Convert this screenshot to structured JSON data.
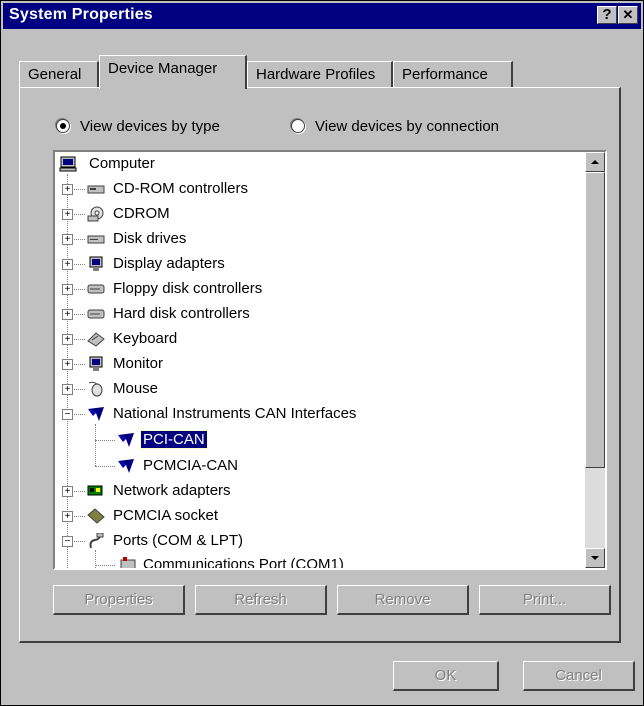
{
  "window": {
    "title": "System Properties",
    "help_label": "?",
    "close_label": "✕"
  },
  "tabs": [
    {
      "label": "General"
    },
    {
      "label": "Device Manager"
    },
    {
      "label": "Hardware Profiles"
    },
    {
      "label": "Performance"
    }
  ],
  "view_options": {
    "by_type": {
      "label": "View devices by type",
      "selected": true
    },
    "by_connection": {
      "label": "View devices by connection",
      "selected": false
    }
  },
  "tree": {
    "root": "Computer",
    "items": [
      {
        "label": "CD-ROM controllers",
        "icon": "cdrom-controller-icon"
      },
      {
        "label": "CDROM",
        "icon": "cdrom-icon"
      },
      {
        "label": "Disk drives",
        "icon": "disk-drive-icon"
      },
      {
        "label": "Display adapters",
        "icon": "display-adapter-icon"
      },
      {
        "label": "Floppy disk controllers",
        "icon": "floppy-controller-icon"
      },
      {
        "label": "Hard disk controllers",
        "icon": "hard-disk-controller-icon"
      },
      {
        "label": "Keyboard",
        "icon": "keyboard-icon"
      },
      {
        "label": "Monitor",
        "icon": "monitor-icon"
      },
      {
        "label": "Mouse",
        "icon": "mouse-icon"
      },
      {
        "label": "National Instruments CAN Interfaces",
        "icon": "ni-can-icon",
        "expanded": true,
        "children": [
          {
            "label": "PCI-CAN",
            "icon": "ni-can-icon",
            "selected": true
          },
          {
            "label": "PCMCIA-CAN",
            "icon": "ni-can-icon"
          }
        ]
      },
      {
        "label": "Network adapters",
        "icon": "network-adapter-icon"
      },
      {
        "label": "PCMCIA socket",
        "icon": "pcmcia-socket-icon"
      },
      {
        "label": "Ports (COM & LPT)",
        "icon": "ports-icon",
        "expanded": true,
        "children": [
          {
            "label": "Communications Port (COM1)",
            "icon": "com-port-icon"
          }
        ]
      }
    ]
  },
  "buttons": {
    "properties": "Properties",
    "refresh": "Refresh",
    "remove": "Remove",
    "print": "Print...",
    "ok": "OK",
    "cancel": "Cancel"
  },
  "colors": {
    "titlebar": "#000080",
    "face": "#c0c0c0",
    "selection": "#000080"
  }
}
